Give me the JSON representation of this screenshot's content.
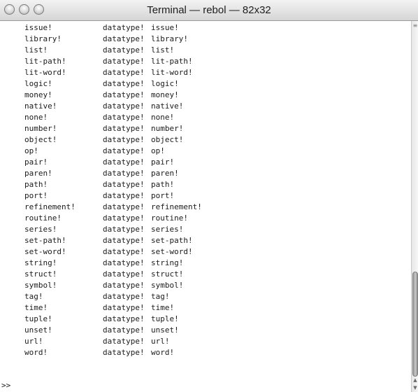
{
  "window": {
    "title": "Terminal — rebol — 82x32"
  },
  "titlebar": {
    "close_glyph": "",
    "minimize_glyph": "",
    "zoom_glyph": ""
  },
  "terminal": {
    "rows": [
      {
        "name": "issue!",
        "type": "datatype!",
        "value": "issue!"
      },
      {
        "name": "library!",
        "type": "datatype!",
        "value": "library!"
      },
      {
        "name": "list!",
        "type": "datatype!",
        "value": "list!"
      },
      {
        "name": "lit-path!",
        "type": "datatype!",
        "value": "lit-path!"
      },
      {
        "name": "lit-word!",
        "type": "datatype!",
        "value": "lit-word!"
      },
      {
        "name": "logic!",
        "type": "datatype!",
        "value": "logic!"
      },
      {
        "name": "money!",
        "type": "datatype!",
        "value": "money!"
      },
      {
        "name": "native!",
        "type": "datatype!",
        "value": "native!"
      },
      {
        "name": "none!",
        "type": "datatype!",
        "value": "none!"
      },
      {
        "name": "number!",
        "type": "datatype!",
        "value": "number!"
      },
      {
        "name": "object!",
        "type": "datatype!",
        "value": "object!"
      },
      {
        "name": "op!",
        "type": "datatype!",
        "value": "op!"
      },
      {
        "name": "pair!",
        "type": "datatype!",
        "value": "pair!"
      },
      {
        "name": "paren!",
        "type": "datatype!",
        "value": "paren!"
      },
      {
        "name": "path!",
        "type": "datatype!",
        "value": "path!"
      },
      {
        "name": "port!",
        "type": "datatype!",
        "value": "port!"
      },
      {
        "name": "refinement!",
        "type": "datatype!",
        "value": "refinement!"
      },
      {
        "name": "routine!",
        "type": "datatype!",
        "value": "routine!"
      },
      {
        "name": "series!",
        "type": "datatype!",
        "value": "series!"
      },
      {
        "name": "set-path!",
        "type": "datatype!",
        "value": "set-path!"
      },
      {
        "name": "set-word!",
        "type": "datatype!",
        "value": "set-word!"
      },
      {
        "name": "string!",
        "type": "datatype!",
        "value": "string!"
      },
      {
        "name": "struct!",
        "type": "datatype!",
        "value": "struct!"
      },
      {
        "name": "symbol!",
        "type": "datatype!",
        "value": "symbol!"
      },
      {
        "name": "tag!",
        "type": "datatype!",
        "value": "tag!"
      },
      {
        "name": "time!",
        "type": "datatype!",
        "value": "time!"
      },
      {
        "name": "tuple!",
        "type": "datatype!",
        "value": "tuple!"
      },
      {
        "name": "unset!",
        "type": "datatype!",
        "value": "unset!"
      },
      {
        "name": "url!",
        "type": "datatype!",
        "value": "url!"
      },
      {
        "name": "word!",
        "type": "datatype!",
        "value": "word!"
      }
    ],
    "prompt": ">>"
  },
  "scrollbar": {
    "icons": [
      "scroll-up-icon",
      "scroll-down-icon"
    ],
    "thumb_color": "#a8a8a8",
    "position_fraction": 0.96
  },
  "colors": {
    "text": "#1a1a1a",
    "background": "#ffffff",
    "titlebar": "#e0e0e0"
  }
}
